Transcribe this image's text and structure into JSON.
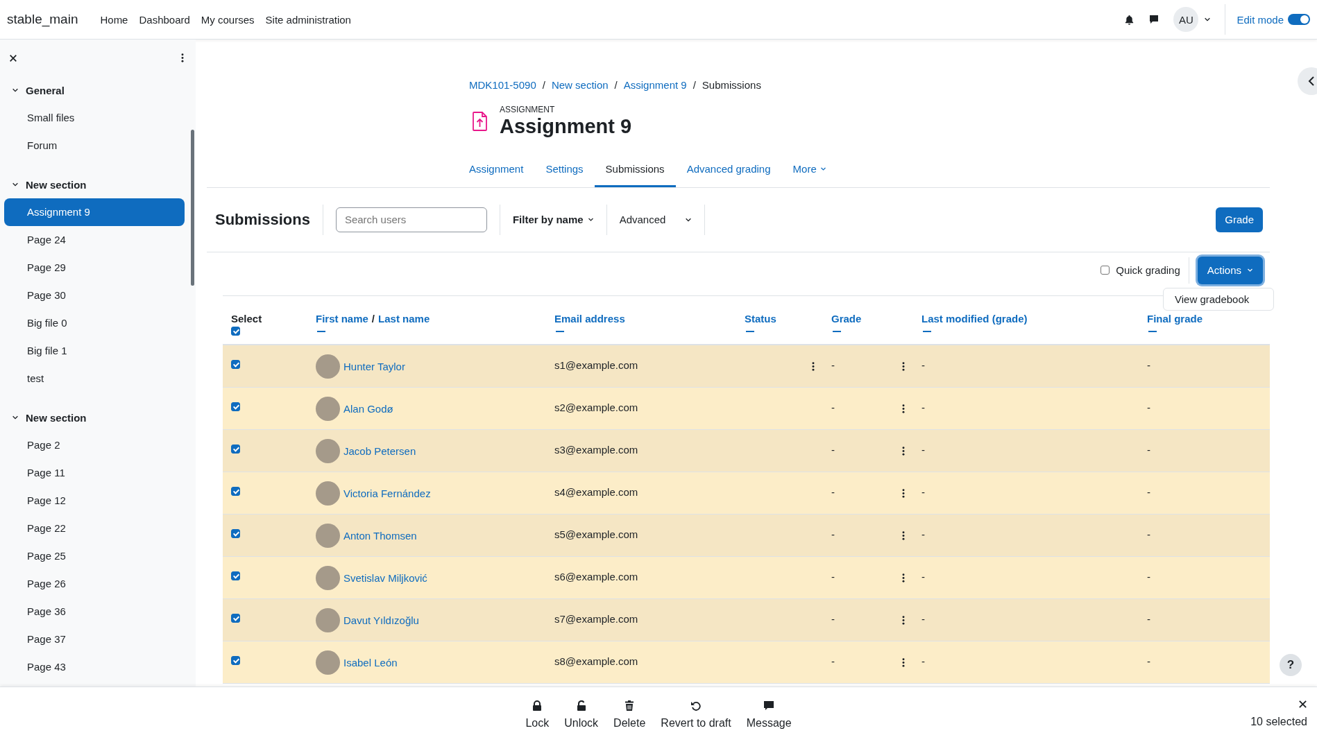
{
  "top_nav": {
    "site_name": "stable_main",
    "links": [
      {
        "label": "Home"
      },
      {
        "label": "Dashboard"
      },
      {
        "label": "My courses"
      },
      {
        "label": "Site administration"
      }
    ],
    "user_initials": "AU",
    "edit_mode": {
      "label": "Edit mode",
      "on": true
    }
  },
  "sidebar": {
    "sections": [
      {
        "title": "General",
        "expanded": true,
        "items": [
          {
            "label": "Small files",
            "selected": false
          },
          {
            "label": "Forum",
            "selected": false
          }
        ]
      },
      {
        "title": "New section",
        "expanded": true,
        "items": [
          {
            "label": "Assignment 9",
            "selected": true
          },
          {
            "label": "Page 24",
            "selected": false
          },
          {
            "label": "Page 29",
            "selected": false
          },
          {
            "label": "Page 30",
            "selected": false
          },
          {
            "label": "Big file 0",
            "selected": false
          },
          {
            "label": "Big file 1",
            "selected": false
          },
          {
            "label": "test",
            "selected": false
          }
        ]
      },
      {
        "title": "New section",
        "expanded": true,
        "items": [
          {
            "label": "Page 2",
            "selected": false
          },
          {
            "label": "Page 11",
            "selected": false
          },
          {
            "label": "Page 12",
            "selected": false
          },
          {
            "label": "Page 22",
            "selected": false
          },
          {
            "label": "Page 25",
            "selected": false
          },
          {
            "label": "Page 26",
            "selected": false
          },
          {
            "label": "Page 36",
            "selected": false
          },
          {
            "label": "Page 37",
            "selected": false
          },
          {
            "label": "Page 43",
            "selected": false
          }
        ]
      }
    ]
  },
  "breadcrumb": [
    {
      "label": "MDK101-5090",
      "link": true
    },
    {
      "separator": "/",
      "label": "New section",
      "link": true
    },
    {
      "separator": "/",
      "label": "Assignment 9",
      "link": true
    },
    {
      "separator": "/",
      "label": "Submissions",
      "link": false
    }
  ],
  "help_button": "?",
  "activity": {
    "type_label": "ASSIGNMENT",
    "title": "Assignment 9"
  },
  "tabs": [
    {
      "label": "Assignment",
      "selected": false,
      "dropdown": false
    },
    {
      "label": "Settings",
      "selected": false,
      "dropdown": false
    },
    {
      "label": "Submissions",
      "selected": true,
      "dropdown": false
    },
    {
      "label": "Advanced grading",
      "selected": false,
      "dropdown": false
    },
    {
      "label": "More",
      "selected": false,
      "dropdown": true
    }
  ],
  "toolbar": {
    "title": "Submissions",
    "search_placeholder": "Search users",
    "filter_label": "Filter by name",
    "advanced_label": "Advanced",
    "grade_button": "Grade"
  },
  "quick_grading": {
    "label": "Quick grading",
    "checked": false
  },
  "actions": {
    "label": "Actions",
    "menu_open": true,
    "menu_items": [
      "View gradebook"
    ]
  },
  "table": {
    "select_label": "Select",
    "select_all_checked": true,
    "columns": [
      {
        "links": [
          "First name",
          "Last name"
        ],
        "separator": "/"
      },
      {
        "links": [
          "Email address"
        ]
      },
      {
        "links": [
          "Status"
        ]
      },
      {
        "links": [
          "Grade"
        ]
      },
      {
        "links": [
          "Last modified (grade)"
        ]
      },
      {
        "links": [
          "Final grade"
        ]
      }
    ],
    "rows": [
      {
        "selected": true,
        "name": "Hunter Taylor",
        "email": "s1@example.com",
        "status_menu": true,
        "grade": "-",
        "grade_menu": true,
        "last_modified": "-",
        "final_grade": "-"
      },
      {
        "selected": true,
        "name": "Alan Godø",
        "email": "s2@example.com",
        "status_menu": false,
        "grade": "-",
        "grade_menu": true,
        "last_modified": "-",
        "final_grade": "-"
      },
      {
        "selected": true,
        "name": "Jacob Petersen",
        "email": "s3@example.com",
        "status_menu": false,
        "grade": "-",
        "grade_menu": true,
        "last_modified": "-",
        "final_grade": "-"
      },
      {
        "selected": true,
        "name": "Victoria Fernández",
        "email": "s4@example.com",
        "status_menu": false,
        "grade": "-",
        "grade_menu": true,
        "last_modified": "-",
        "final_grade": "-"
      },
      {
        "selected": true,
        "name": "Anton Thomsen",
        "email": "s5@example.com",
        "status_menu": false,
        "grade": "-",
        "grade_menu": true,
        "last_modified": "-",
        "final_grade": "-"
      },
      {
        "selected": true,
        "name": "Svetislav Miljković",
        "email": "s6@example.com",
        "status_menu": false,
        "grade": "-",
        "grade_menu": true,
        "last_modified": "-",
        "final_grade": "-"
      },
      {
        "selected": true,
        "name": "Davut Yıldızoğlu",
        "email": "s7@example.com",
        "status_menu": false,
        "grade": "-",
        "grade_menu": true,
        "last_modified": "-",
        "final_grade": "-"
      },
      {
        "selected": true,
        "name": "Isabel León",
        "email": "s8@example.com",
        "status_menu": false,
        "grade": "-",
        "grade_menu": true,
        "last_modified": "-",
        "final_grade": "-"
      }
    ]
  },
  "bulk_bar": {
    "actions": [
      {
        "label": "Lock",
        "kind": "lock"
      },
      {
        "label": "Unlock",
        "kind": "unlock"
      },
      {
        "label": "Delete",
        "kind": "delete"
      },
      {
        "label": "Revert to draft",
        "kind": "revert"
      },
      {
        "label": "Message",
        "kind": "message"
      }
    ],
    "count": "10 selected"
  }
}
